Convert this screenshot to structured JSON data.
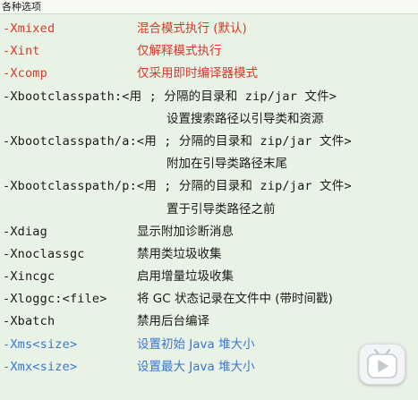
{
  "header": {
    "title": "各种选项"
  },
  "rows": [
    {
      "option": "-Xmixed",
      "description": "混合模式执行 (默认)",
      "style": "red"
    },
    {
      "option": "-Xint",
      "description": "仅解释模式执行",
      "style": "red"
    },
    {
      "option": "-Xcomp",
      "description": "仅采用即时编译器模式",
      "style": "red"
    },
    {
      "option": "-Xbootclasspath:<用 ; 分隔的目录和 zip/jar 文件>",
      "description": "",
      "style": "black"
    },
    {
      "option": "",
      "description": "设置搜索路径以引导类和资源",
      "style": "black",
      "indent": true
    },
    {
      "option": "-Xbootclasspath/a:<用 ; 分隔的目录和 zip/jar 文件>",
      "description": "",
      "style": "black"
    },
    {
      "option": "",
      "description": "附加在引导类路径末尾",
      "style": "black",
      "indent": true
    },
    {
      "option": "-Xbootclasspath/p:<用 ; 分隔的目录和 zip/jar 文件>",
      "description": "",
      "style": "black"
    },
    {
      "option": "",
      "description": "置于引导类路径之前",
      "style": "black",
      "indent": true
    },
    {
      "option": "-Xdiag",
      "description": "显示附加诊断消息",
      "style": "black"
    },
    {
      "option": "-Xnoclassgc",
      "description": "禁用类垃圾收集",
      "style": "black"
    },
    {
      "option": "-Xincgc",
      "description": "启用增量垃圾收集",
      "style": "black"
    },
    {
      "option": "-Xloggc:<file>",
      "description": "将 GC 状态记录在文件中 (带时间戳)",
      "style": "black"
    },
    {
      "option": "-Xbatch",
      "description": "禁用后台编译",
      "style": "black"
    },
    {
      "option": "-Xms<size>",
      "description": "设置初始 Java 堆大小",
      "style": "blue"
    },
    {
      "option": "-Xmx<size>",
      "description": "设置最大 Java 堆大小",
      "style": "blue"
    }
  ],
  "overlay": {
    "icon": "play-badge-icon"
  },
  "colors": {
    "background": "#e9f3e5",
    "red": "#d8392b",
    "black": "#1a1a1a",
    "blue": "#3a76d2"
  }
}
